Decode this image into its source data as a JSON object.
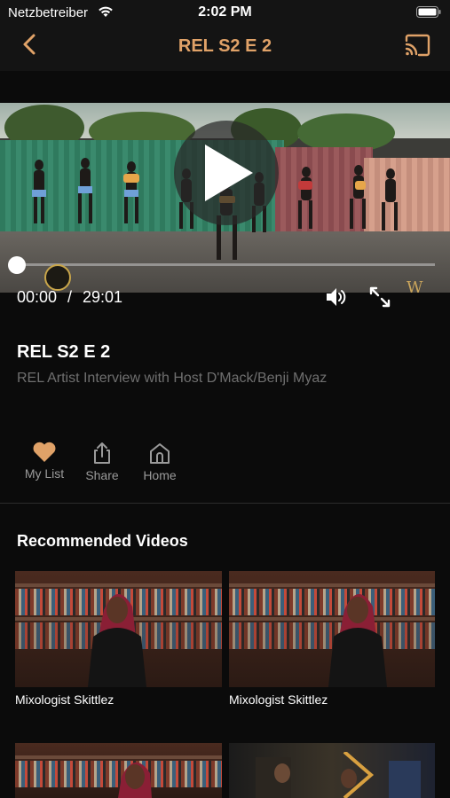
{
  "status_bar": {
    "carrier": "Netzbetreiber",
    "time": "2:02 PM"
  },
  "nav": {
    "title": "REL S2 E 2"
  },
  "player": {
    "current_time": "00:00",
    "separator": "/",
    "duration": "29:01",
    "progress": 0
  },
  "video": {
    "title": "REL S2 E 2",
    "subtitle": "REL Artist Interview with Host D'Mack/Benji Myaz"
  },
  "actions": {
    "my_list": "My List",
    "share": "Share",
    "home": "Home"
  },
  "recommended": {
    "heading": "Recommended Videos",
    "items": [
      {
        "label": "Mixologist Skittlez"
      },
      {
        "label": "Mixologist Skittlez"
      },
      {
        "label": ""
      },
      {
        "label": ""
      }
    ]
  },
  "colors": {
    "accent": "#e0a268",
    "background": "#0b0b0b",
    "subtitle": "#6f6f6f"
  }
}
